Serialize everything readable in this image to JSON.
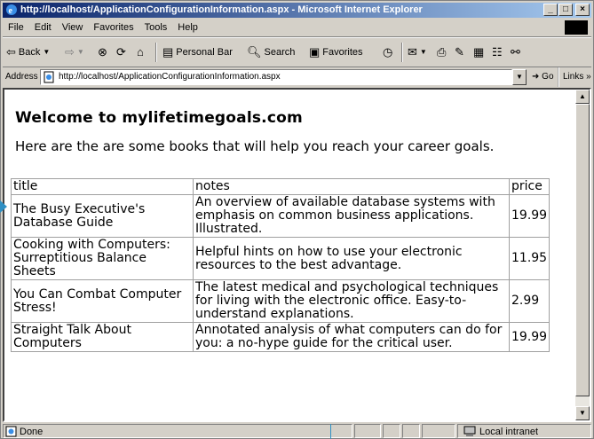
{
  "window": {
    "title": "http://localhost/ApplicationConfigurationInformation.aspx - Microsoft Internet Explorer",
    "controls": [
      "_",
      "□",
      "×"
    ]
  },
  "menu": [
    "File",
    "Edit",
    "View",
    "Favorites",
    "Tools",
    "Help"
  ],
  "toolbar": {
    "back": "Back",
    "personal_bar": "Personal Bar",
    "search": "Search",
    "favorites": "Favorites"
  },
  "address": {
    "label": "Address",
    "url": "http://localhost/ApplicationConfigurationInformation.aspx",
    "go": "Go",
    "links": "Links"
  },
  "page": {
    "heading": "Welcome to mylifetimegoals.com",
    "intro": "Here are the are some books that will help you reach your career goals.",
    "table": {
      "headers": [
        "title",
        "notes",
        "price"
      ],
      "rows": [
        [
          "The Busy Executive's Database Guide",
          "An overview of available database systems with emphasis on common business applications. Illustrated.",
          "19.99"
        ],
        [
          "Cooking with Computers: Surreptitious Balance Sheets",
          "Helpful hints on how to use your electronic resources to the best advantage.",
          "11.95"
        ],
        [
          "You Can Combat Computer Stress!",
          "The latest medical and psychological techniques for living with the electronic office. Easy-to-understand explanations.",
          "2.99"
        ],
        [
          "Straight Talk About Computers",
          "Annotated analysis of what computers can do for you: a no-hype guide for the critical user.",
          "19.99"
        ]
      ]
    }
  },
  "status": {
    "text": "Done",
    "zone": "Local intranet"
  }
}
